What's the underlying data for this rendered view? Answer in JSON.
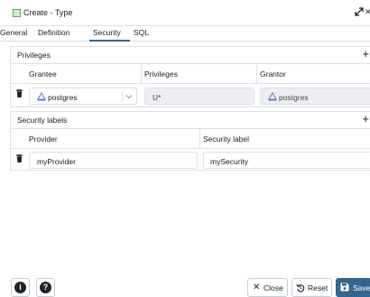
{
  "dialog": {
    "title": "Create - Type"
  },
  "tabs": [
    {
      "label": "General"
    },
    {
      "label": "Definition"
    },
    {
      "label": "Security"
    },
    {
      "label": "SQL"
    }
  ],
  "active_tab": "Security",
  "privileges": {
    "title": "Privileges",
    "columns": [
      "Grantee",
      "Privileges",
      "Grantor"
    ],
    "rows": [
      {
        "grantee": "postgres",
        "privileges": "U*",
        "grantor": "postgres"
      }
    ]
  },
  "security_labels": {
    "title": "Security labels",
    "columns": [
      "Provider",
      "Security label"
    ],
    "rows": [
      {
        "provider": "myProvider",
        "security_label": "mySecurity"
      }
    ]
  },
  "footer": {
    "info_label": "i",
    "help_label": "?",
    "close_label": "Close",
    "reset_label": "Reset",
    "save_label": "Save"
  },
  "colors": {
    "accent": "#326690",
    "border": "#dde0e6",
    "disabled_field": "#eceef1"
  }
}
